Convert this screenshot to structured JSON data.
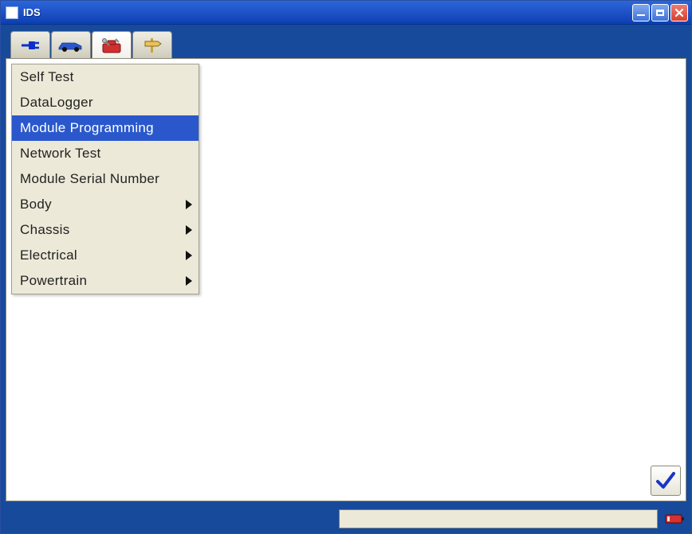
{
  "window": {
    "title": "IDS"
  },
  "toolbar": {
    "tabs": [
      {
        "icon": "plug-icon"
      },
      {
        "icon": "car-icon"
      },
      {
        "icon": "toolbox-icon"
      },
      {
        "icon": "signpost-icon"
      }
    ],
    "active_index": 2
  },
  "menu": {
    "items": [
      {
        "label": "Self Test",
        "has_sub": false,
        "selected": false
      },
      {
        "label": "DataLogger",
        "has_sub": false,
        "selected": false
      },
      {
        "label": "Module Programming",
        "has_sub": false,
        "selected": true
      },
      {
        "label": "Network Test",
        "has_sub": false,
        "selected": false
      },
      {
        "label": "Module Serial Number",
        "has_sub": false,
        "selected": false
      },
      {
        "label": "Body",
        "has_sub": true,
        "selected": false
      },
      {
        "label": "Chassis",
        "has_sub": true,
        "selected": false
      },
      {
        "label": "Electrical",
        "has_sub": true,
        "selected": false
      },
      {
        "label": "Powertrain",
        "has_sub": true,
        "selected": false
      }
    ]
  },
  "confirm": {
    "name": "confirm-button"
  },
  "status": {
    "battery_icon": "battery-icon"
  }
}
